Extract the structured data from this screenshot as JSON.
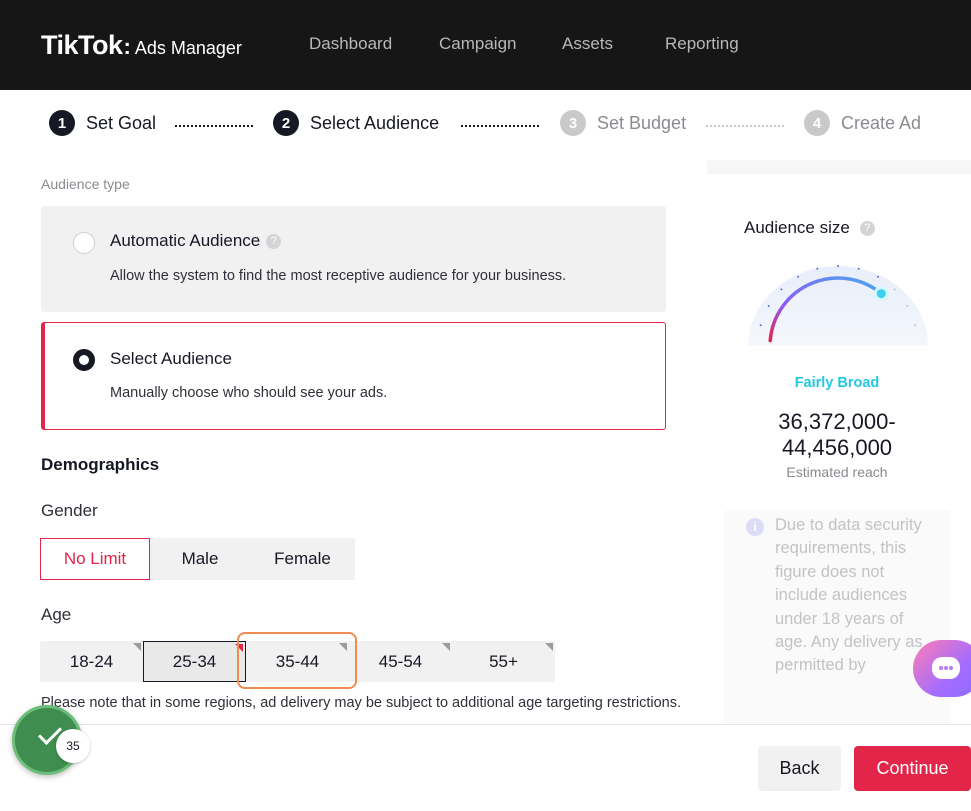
{
  "header": {
    "logo_main": "TikTok",
    "logo_colon": ":",
    "logo_sub": "Ads Manager",
    "nav": [
      "Dashboard",
      "Campaign",
      "Assets",
      "Reporting"
    ]
  },
  "steps": [
    {
      "num": "1",
      "label": "Set Goal"
    },
    {
      "num": "2",
      "label": "Select Audience"
    },
    {
      "num": "3",
      "label": "Set Budget"
    },
    {
      "num": "4",
      "label": "Create Ad"
    }
  ],
  "audience_type": {
    "label": "Audience type",
    "automatic": {
      "title": "Automatic Audience",
      "help": "?",
      "desc": "Allow the system to find the most receptive audience for your business."
    },
    "select": {
      "title": "Select Audience",
      "desc": "Manually choose who should see your ads."
    }
  },
  "demographics": {
    "title": "Demographics",
    "gender_label": "Gender",
    "gender_options": [
      "No Limit",
      "Male",
      "Female"
    ],
    "gender_selected": "No Limit",
    "age_label": "Age",
    "age_options": [
      "18-24",
      "25-34",
      "35-44",
      "45-54",
      "55+"
    ],
    "age_selected": "25-34",
    "age_note": "Please note that in some regions, ad delivery may be subject to additional age targeting restrictions."
  },
  "audience_size": {
    "title": "Audience size",
    "help": "?",
    "status": "Fairly Broad",
    "range_line1": "36,372,000-",
    "range_line2": "44,456,000",
    "caption": "Estimated reach",
    "info_icon": "i",
    "info_text": "Due to data security requirements, this figure does not include audiences under 18 years of age. Any delivery as permitted by",
    "gauge_level": 0.72
  },
  "badge": {
    "count": "35"
  },
  "footer": {
    "back": "Back",
    "continue": "Continue"
  },
  "colors": {
    "accent": "#e3254a",
    "teal": "#25c8e3",
    "header_bg": "#161616"
  }
}
